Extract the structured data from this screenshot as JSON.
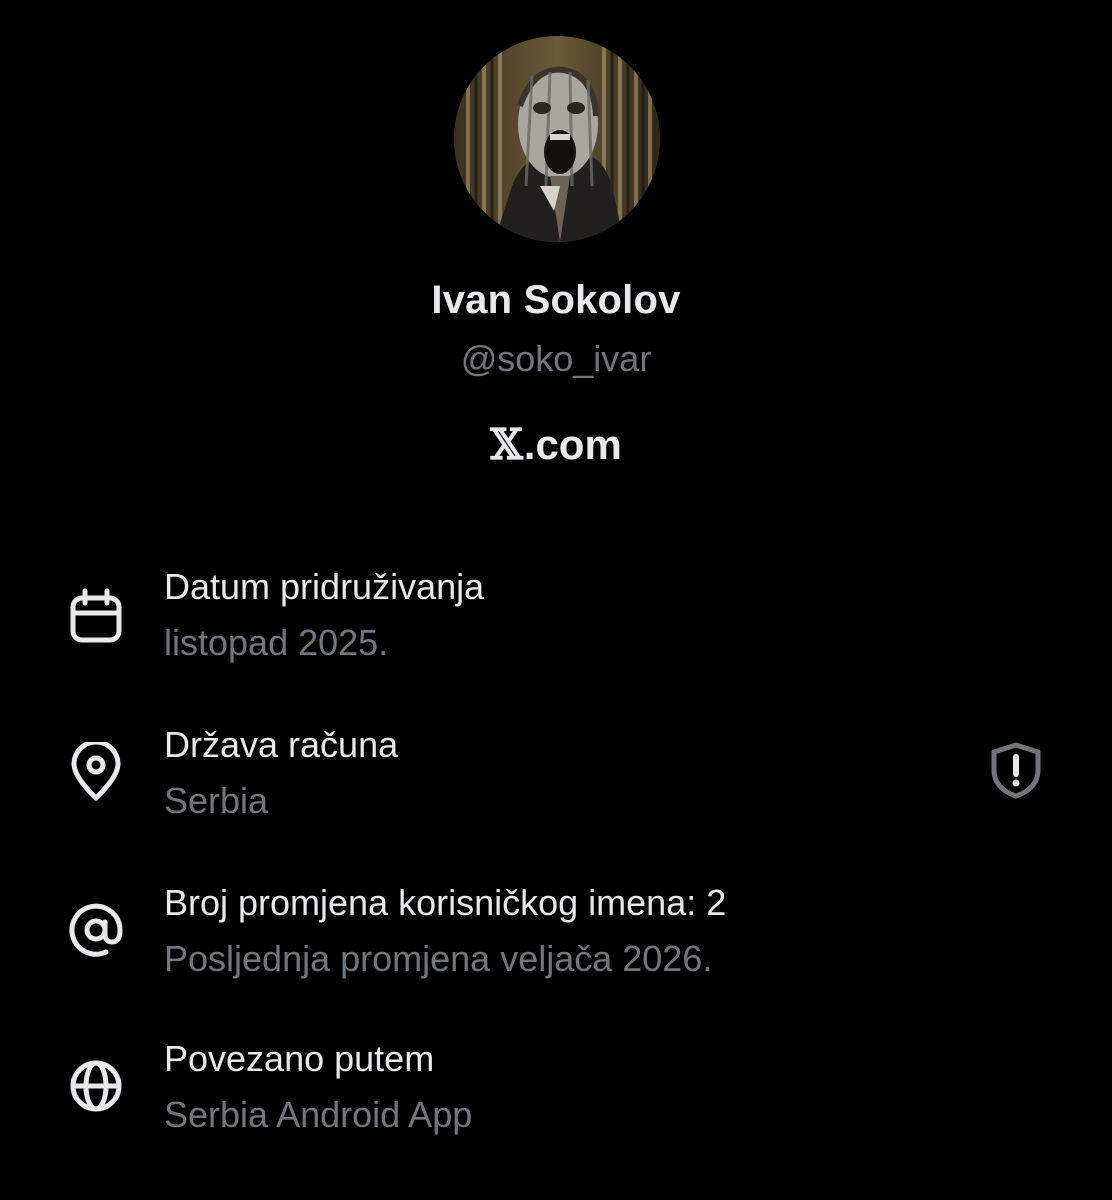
{
  "profile": {
    "display_name": "Ivan Sokolov",
    "handle": "@soko_ivar",
    "avatar_icon": "profile-photo",
    "brand": {
      "mark": "𝕏",
      "text": ".com"
    }
  },
  "details": [
    {
      "icon": "calendar-icon",
      "label": "Datum pridruživanja",
      "value": "listopad 2025."
    },
    {
      "icon": "location-pin-icon",
      "label": "Država računa",
      "value": "Serbia",
      "trailing_icon": "shield-alert-icon"
    },
    {
      "icon": "at-sign-icon",
      "label": "Broj promjena korisničkog imena: 2",
      "value": "Posljednja promjena veljača 2026."
    },
    {
      "icon": "globe-icon",
      "label": "Povezano putem",
      "value": "Serbia Android App"
    }
  ],
  "colors": {
    "background": "#000000",
    "primary_text": "#e7e9ea",
    "secondary_text": "#71767b",
    "icon": "#e7e9ea",
    "shield_icon": "#71767b"
  }
}
